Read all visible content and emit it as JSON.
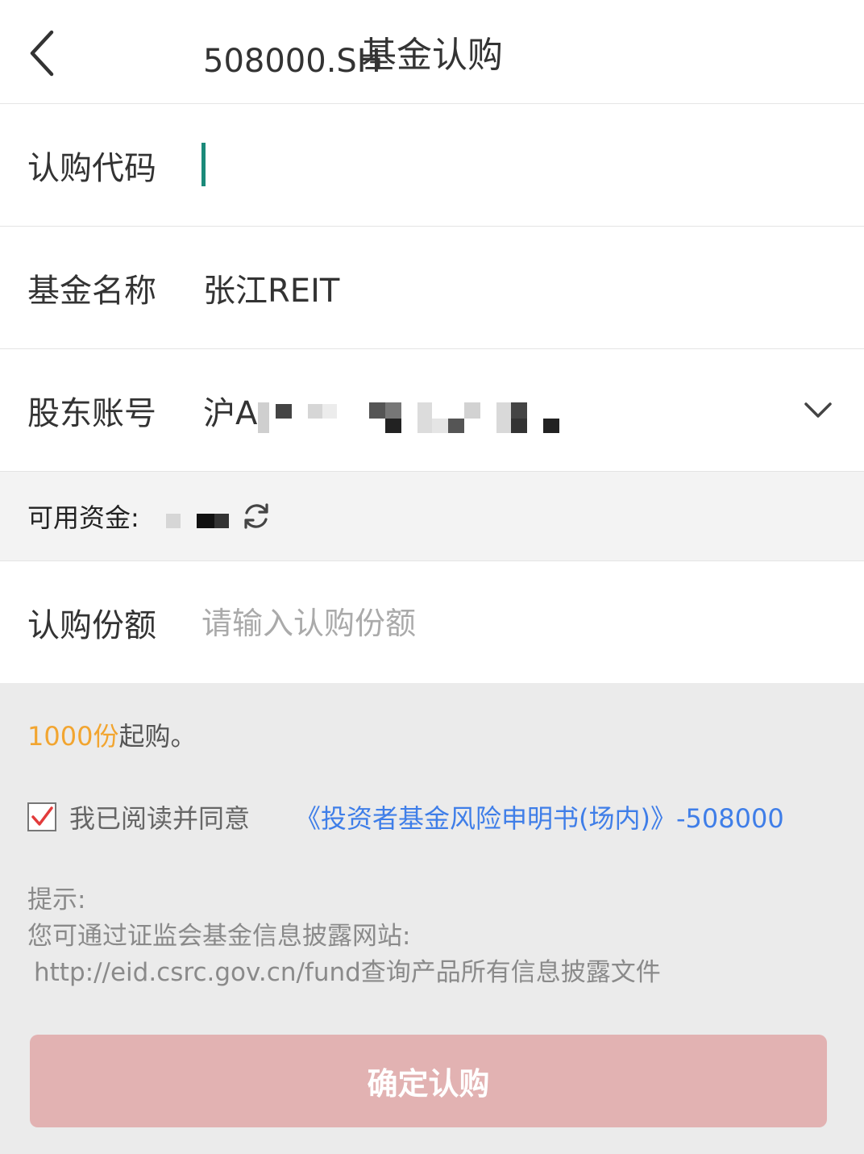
{
  "header": {
    "title": "基金认购"
  },
  "form": {
    "code": {
      "label": "认购代码",
      "value": "508000.SH"
    },
    "fund_name": {
      "label": "基金名称",
      "value": "张江REIT"
    },
    "account": {
      "label": "股东账号",
      "prefix": "沪A"
    },
    "available_funds": {
      "label": "可用资金:"
    },
    "amount": {
      "label": "认购份额",
      "placeholder": "请输入认购份额",
      "value": ""
    }
  },
  "notes": {
    "min_amount": "1000份",
    "min_suffix": "起购。",
    "agree_text": "我已阅读并同意",
    "agree_checked": true,
    "agreement_link": "《投资者基金风险申明书(场内)》-508000",
    "tips_title": "提示:",
    "tips_line1": "您可通过证监会基金信息披露网站:",
    "tips_line2": "http://eid.csrc.gov.cn/fund查询产品所有信息披露文件"
  },
  "submit_label": "确定认购",
  "colors": {
    "accent_orange": "#f2a530",
    "link_blue": "#3f7ee8",
    "submit_disabled": "#e2b2b2",
    "check_red": "#e23b3b",
    "caret": "#1b8a7a"
  },
  "icons": [
    "back-arrow-icon",
    "chevron-down-icon",
    "refresh-icon",
    "checkmark-icon"
  ]
}
